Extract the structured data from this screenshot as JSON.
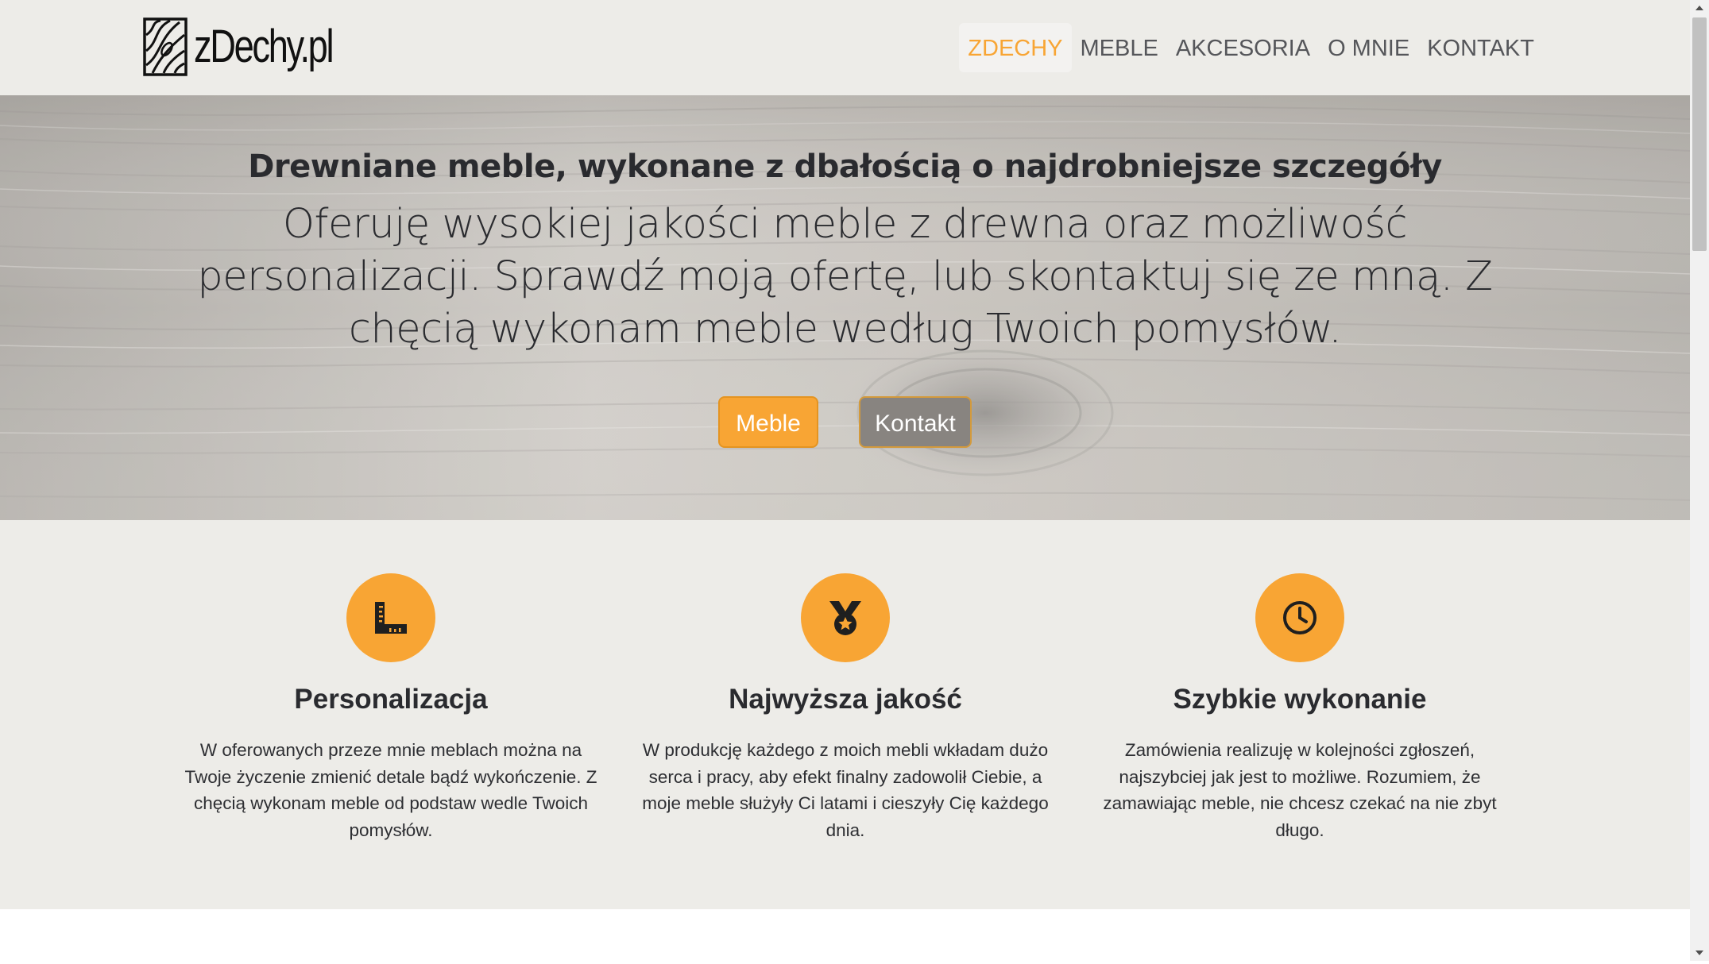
{
  "brand": {
    "name": "zDechy.pl"
  },
  "nav": {
    "items": [
      {
        "label": "ZDECHY",
        "active": true
      },
      {
        "label": "MEBLE",
        "active": false
      },
      {
        "label": "AKCESORIA",
        "active": false
      },
      {
        "label": "O MNIE",
        "active": false
      },
      {
        "label": "KONTAKT",
        "active": false
      }
    ]
  },
  "hero": {
    "title": "Drewniane meble, wykonane z dbałością o najdrobniejsze szczegóły",
    "lead": "Oferuję wysokiej jakości meble z drewna oraz możliwość personalizacji. Sprawdź moją ofertę, lub skontaktuj się ze mną. Z chęcią wykonam meble według Twoich pomysłów.",
    "primary_button": "Meble",
    "secondary_button": "Kontakt"
  },
  "features": [
    {
      "icon": "ruler-combined-icon",
      "title": "Personalizacja",
      "text": "W oferowanych przeze mnie meblach można na Twoje życzenie zmienić detale bądź wykończenie. Z chęcią wykonam meble od podstaw wedle Twoich pomysłów."
    },
    {
      "icon": "medal-icon",
      "title": "Najwyższa jakość",
      "text": "W produkcję każdego z moich mebli wkładam dużo serca i pracy, aby efekt finalny zadowolił Ciebie, a moje meble służyły Ci latami i cieszyły Cię każdego dnia."
    },
    {
      "icon": "clock-icon",
      "title": "Szybkie wykonanie",
      "text": "Zamówienia realizuję w kolejności zgłoszeń, najszybciej jak jest to możliwe. Rozumiem, że zamawiając meble, nie chcesz czekać na nie zbyt długo."
    }
  ],
  "colors": {
    "accent": "#f8a534",
    "background": "#edece8",
    "text": "#2a2b2f"
  }
}
